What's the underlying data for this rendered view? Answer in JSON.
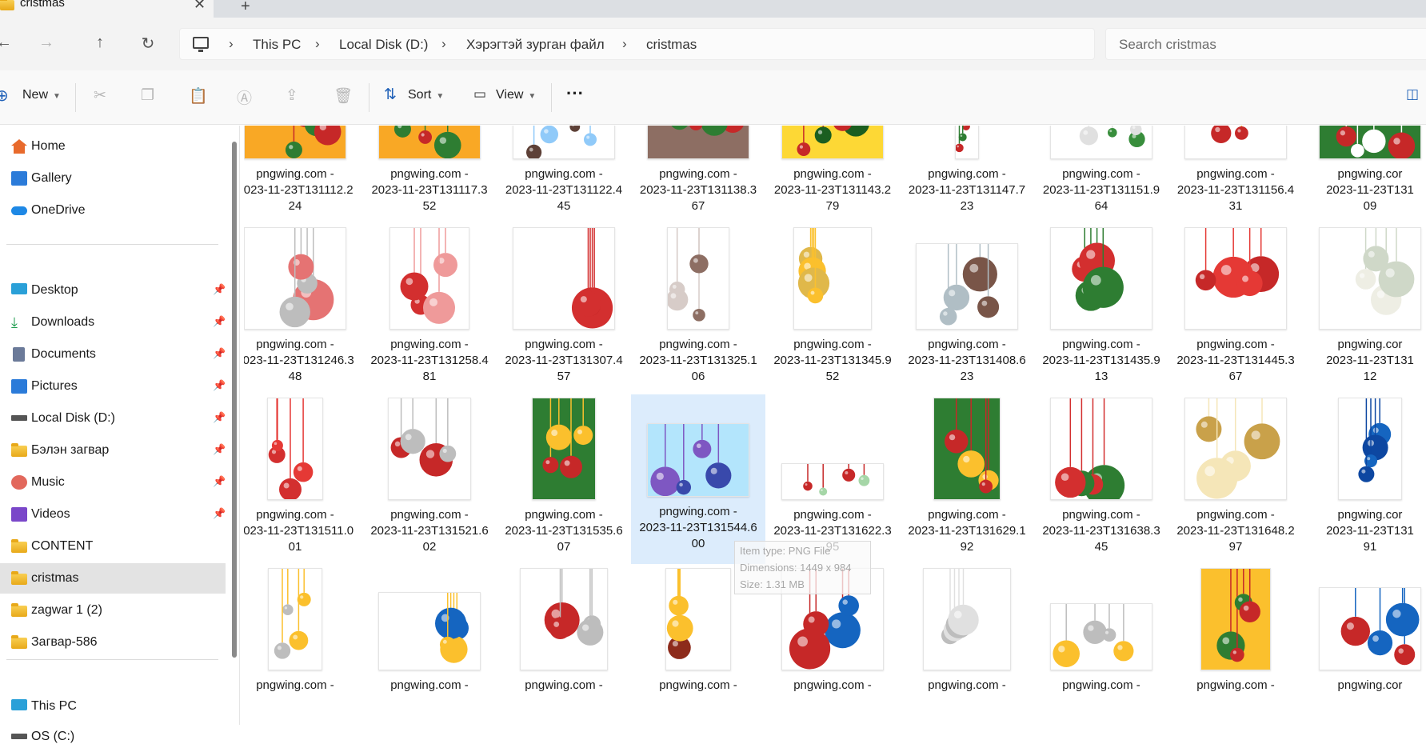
{
  "tab": {
    "title": "cristmas",
    "close": "✕",
    "new": "+"
  },
  "nav": {
    "back": "←",
    "forward": "→",
    "up": "↑",
    "refresh": "↻"
  },
  "breadcrumb": [
    "This PC",
    "Local Disk (D:)",
    "Хэрэгтэй зурган файл",
    "cristmas"
  ],
  "breadcrumb_sep": "›",
  "search": {
    "placeholder": "Search cristmas"
  },
  "toolbar": {
    "new_label": "New",
    "sort_label": "Sort",
    "view_label": "View",
    "more_label": "···"
  },
  "sidebar": {
    "quick": [
      {
        "label": "Home",
        "icon": "home-icon"
      },
      {
        "label": "Gallery",
        "icon": "gallery-icon"
      },
      {
        "label": "OneDrive",
        "icon": "cloud-icon"
      }
    ],
    "pinned": [
      {
        "label": "Desktop",
        "icon": "desktop-icon",
        "pinned": true
      },
      {
        "label": "Downloads",
        "icon": "download-icon",
        "pinned": true
      },
      {
        "label": "Documents",
        "icon": "documents-icon",
        "pinned": true
      },
      {
        "label": "Pictures",
        "icon": "pictures-icon",
        "pinned": true
      },
      {
        "label": "Local Disk (D:)",
        "icon": "drive-icon",
        "pinned": true
      },
      {
        "label": "Бэлэн загвар",
        "icon": "folder-icon",
        "pinned": true
      },
      {
        "label": "Music",
        "icon": "music-icon",
        "pinned": true
      },
      {
        "label": "Videos",
        "icon": "videos-icon",
        "pinned": true
      },
      {
        "label": "CONTENT",
        "icon": "folder-icon",
        "pinned": false
      },
      {
        "label": "cristmas",
        "icon": "folder-icon",
        "pinned": false,
        "selected": true
      },
      {
        "label": "zagwar 1 (2)",
        "icon": "folder-icon",
        "pinned": false
      },
      {
        "label": "Загвар-586",
        "icon": "folder-icon",
        "pinned": false
      }
    ],
    "bottom": [
      {
        "label": "This PC",
        "icon": "pc-icon"
      },
      {
        "label": "OS (C:)",
        "icon": "drive-icon"
      }
    ]
  },
  "files": [
    {
      "l1": "pngwing.com -",
      "l2": "2023-11-23T131112.2",
      "l3": "24"
    },
    {
      "l1": "pngwing.com -",
      "l2": "2023-11-23T131117.3",
      "l3": "52"
    },
    {
      "l1": "pngwing.com -",
      "l2": "2023-11-23T131122.4",
      "l3": "45"
    },
    {
      "l1": "pngwing.com -",
      "l2": "2023-11-23T131138.3",
      "l3": "67"
    },
    {
      "l1": "pngwing.com -",
      "l2": "2023-11-23T131143.2",
      "l3": "79"
    },
    {
      "l1": "pngwing.com -",
      "l2": "2023-11-23T131147.7",
      "l3": "23"
    },
    {
      "l1": "pngwing.com -",
      "l2": "2023-11-23T131151.9",
      "l3": "64"
    },
    {
      "l1": "pngwing.com -",
      "l2": "2023-11-23T131156.4",
      "l3": "31"
    },
    {
      "l1": "pngwing.cor",
      "l2": "2023-11-23T131",
      "l3": "09"
    },
    {
      "l1": "pngwing.com -",
      "l2": "2023-11-23T131246.3",
      "l3": "48"
    },
    {
      "l1": "pngwing.com -",
      "l2": "2023-11-23T131258.4",
      "l3": "81"
    },
    {
      "l1": "pngwing.com -",
      "l2": "2023-11-23T131307.4",
      "l3": "57"
    },
    {
      "l1": "pngwing.com -",
      "l2": "2023-11-23T131325.1",
      "l3": "06"
    },
    {
      "l1": "pngwing.com -",
      "l2": "2023-11-23T131345.9",
      "l3": "52"
    },
    {
      "l1": "pngwing.com -",
      "l2": "2023-11-23T131408.6",
      "l3": "23"
    },
    {
      "l1": "pngwing.com -",
      "l2": "2023-11-23T131435.9",
      "l3": "13"
    },
    {
      "l1": "pngwing.com -",
      "l2": "2023-11-23T131445.3",
      "l3": "67"
    },
    {
      "l1": "pngwing.cor",
      "l2": "2023-11-23T131",
      "l3": "12"
    },
    {
      "l1": "pngwing.com -",
      "l2": "2023-11-23T131511.0",
      "l3": "01"
    },
    {
      "l1": "pngwing.com -",
      "l2": "2023-11-23T131521.6",
      "l3": "02"
    },
    {
      "l1": "pngwing.com -",
      "l2": "2023-11-23T131535.6",
      "l3": "07"
    },
    {
      "l1": "pngwing.com -",
      "l2": "2023-11-23T131544.6",
      "l3": "00"
    },
    {
      "l1": "pngwing.com -",
      "l2": "2023-11-23T131622.3",
      "l3": "95"
    },
    {
      "l1": "pngwing.com -",
      "l2": "2023-11-23T131629.1",
      "l3": "92"
    },
    {
      "l1": "pngwing.com -",
      "l2": "2023-11-23T131638.3",
      "l3": "45"
    },
    {
      "l1": "pngwing.com -",
      "l2": "2023-11-23T131648.2",
      "l3": "97"
    },
    {
      "l1": "pngwing.cor",
      "l2": "2023-11-23T131",
      "l3": "91"
    },
    {
      "l1": "pngwing.com -",
      "l2": "",
      "l3": ""
    },
    {
      "l1": "pngwing.com -",
      "l2": "",
      "l3": ""
    },
    {
      "l1": "pngwing.com -",
      "l2": "",
      "l3": ""
    },
    {
      "l1": "pngwing.com -",
      "l2": "",
      "l3": ""
    },
    {
      "l1": "pngwing.com -",
      "l2": "",
      "l3": ""
    },
    {
      "l1": "pngwing.com -",
      "l2": "",
      "l3": ""
    },
    {
      "l1": "pngwing.com -",
      "l2": "",
      "l3": ""
    },
    {
      "l1": "pngwing.com -",
      "l2": "",
      "l3": ""
    },
    {
      "l1": "pngwing.cor",
      "l2": "",
      "l3": ""
    }
  ],
  "thumb_colors": [
    [
      "#2e7d32",
      "#c62828",
      "#f9a825"
    ],
    [
      "#c62828",
      "#2e7d32",
      "#f9a825"
    ],
    [
      "#5d4037",
      "#90caf9",
      "#ffffff"
    ],
    [
      "#2e7d32",
      "#c62828",
      "#8d6e63"
    ],
    [
      "#1b5e20",
      "#c62828",
      "#fdd835"
    ],
    [
      "#c62828",
      "#2e7d32",
      "#ffffff"
    ],
    [
      "#388e3c",
      "#e0e0e0",
      "#ffffff"
    ],
    [
      "#c62828",
      "#fbc02d",
      "#ffffff"
    ],
    [
      "#c62828",
      "#ffffff",
      "#2e7d32"
    ],
    [
      "#e57373",
      "#bdbdbd",
      "#ffffff"
    ],
    [
      "#d32f2f",
      "#ef9a9a",
      "#ffffff"
    ],
    [
      "#c62828",
      "#d32f2f",
      "#ffffff"
    ],
    [
      "#8d6e63",
      "#d7ccc8",
      "#ffffff"
    ],
    [
      "#e0b84a",
      "#fbc02d",
      "#ffffff"
    ],
    [
      "#795548",
      "#b0bec5",
      "#ffffff"
    ],
    [
      "#d32f2f",
      "#2e7d32",
      "#ffffff"
    ],
    [
      "#c62828",
      "#e53935",
      "#ffffff"
    ],
    [
      "#eeeee4",
      "#cfd8c8",
      "#ffffff"
    ],
    [
      "#d32f2f",
      "#e53935",
      "#ffffff"
    ],
    [
      "#c62828",
      "#bdbdbd",
      "#ffffff"
    ],
    [
      "#c62828",
      "#fbc02d",
      "#2e7d32"
    ],
    [
      "#3949ab",
      "#7e57c2",
      "#b3e5fc"
    ],
    [
      "#a5d6a7",
      "#c62828",
      "#ffffff"
    ],
    [
      "#fbc02d",
      "#c62828",
      "#2e7d32"
    ],
    [
      "#2e7d32",
      "#d32f2f",
      "#ffffff"
    ],
    [
      "#c9a14a",
      "#f5e6b8",
      "#ffffff"
    ],
    [
      "#1565c0",
      "#0d47a1",
      "#ffffff"
    ],
    [
      "#bdbdbd",
      "#fbc02d",
      "#ffffff"
    ],
    [
      "#1565c0",
      "#fbc02d",
      "#ffffff"
    ],
    [
      "#c62828",
      "#bdbdbd",
      "#ffffff"
    ],
    [
      "#8d2b1b",
      "#fbc02d",
      "#ffffff"
    ],
    [
      "#1565c0",
      "#c62828",
      "#ffffff"
    ],
    [
      "#bdbdbd",
      "#e0e0e0",
      "#ffffff"
    ],
    [
      "#fbc02d",
      "#bdbdbd",
      "#ffffff"
    ],
    [
      "#2e7d32",
      "#c62828",
      "#fbc02d"
    ],
    [
      "#c62828",
      "#1565c0",
      "#ffffff"
    ]
  ],
  "tooltip": {
    "type": "Item type: PNG File",
    "dimensions": "Dimensions: 1449 x 984",
    "size": "Size: 1.31 MB"
  },
  "selected_file_index": 21
}
